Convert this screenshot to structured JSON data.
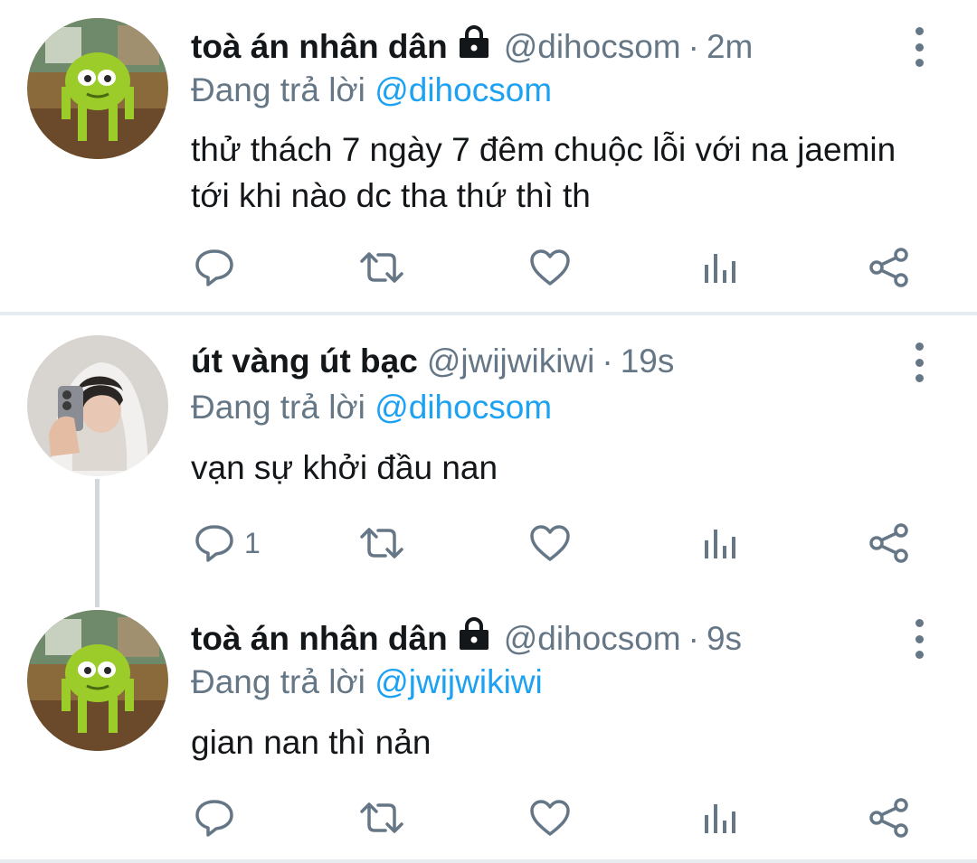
{
  "tweets": [
    {
      "name": "toà án nhân dân",
      "locked": true,
      "handle": "@dihocsom",
      "separator": "·",
      "time": "2m",
      "reply_prefix": "Đang trả lời",
      "reply_to": "@dihocsom",
      "text": "thử thách 7 ngày 7 đêm chuộc lỗi với na jaemin tới khi nào dc tha thứ thì th",
      "reply_count": ""
    },
    {
      "name": "út vàng út bạc",
      "locked": false,
      "handle": "@jwijwikiwi",
      "separator": "·",
      "time": "19s",
      "reply_prefix": "Đang trả lời",
      "reply_to": "@dihocsom",
      "text": "vạn sự khởi đầu nan",
      "reply_count": "1"
    },
    {
      "name": "toà án nhân dân",
      "locked": true,
      "handle": "@dihocsom",
      "separator": "·",
      "time": "9s",
      "reply_prefix": "Đang trả lời",
      "reply_to": "@jwijwikiwi",
      "text": "gian nan thì nản",
      "reply_count": ""
    }
  ],
  "colors": {
    "text": "#14171a",
    "secondary": "#657786",
    "mention": "#1da1f2",
    "divider": "#e6ecf0"
  },
  "icons": [
    "lock-icon",
    "more-icon",
    "reply-icon",
    "retweet-icon",
    "like-icon",
    "analytics-icon",
    "share-icon"
  ]
}
